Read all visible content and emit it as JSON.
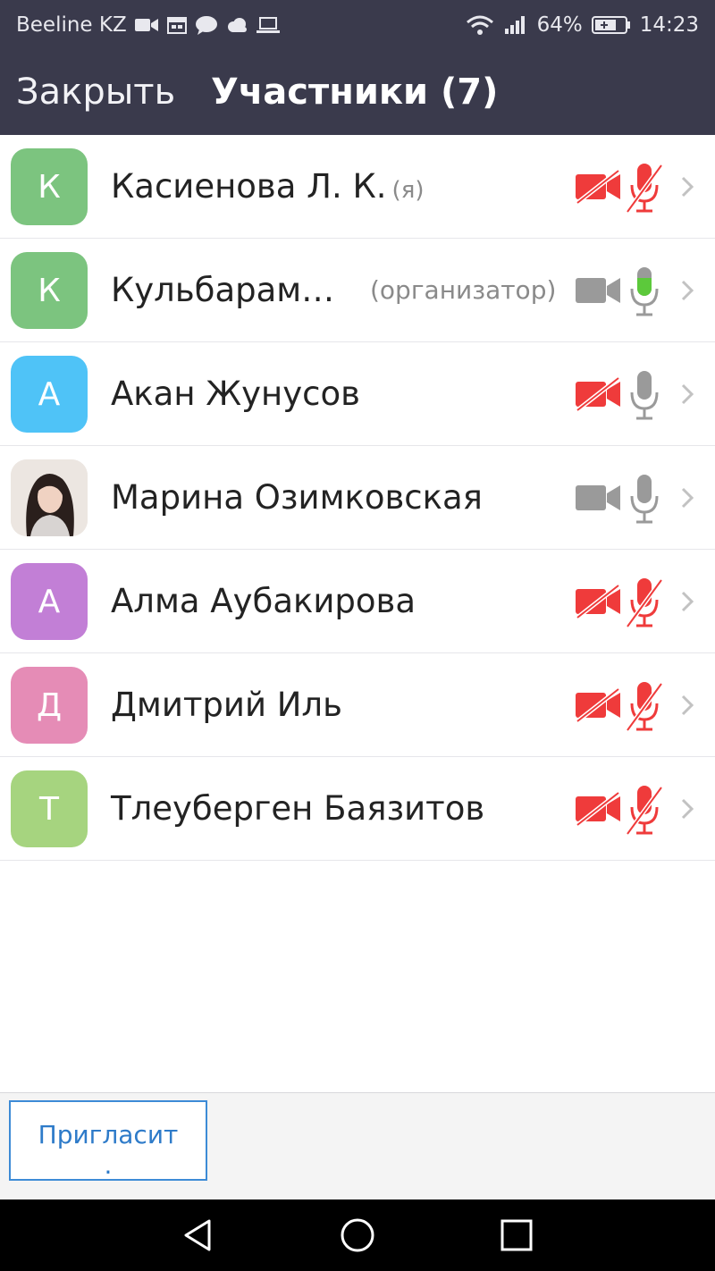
{
  "status_bar": {
    "carrier": "Beeline KZ",
    "battery": "64%",
    "time": "14:23"
  },
  "header": {
    "close_label": "Закрыть",
    "title": "Участники (7)"
  },
  "participants": [
    {
      "initial": "К",
      "name": "Касиенова Л. К.",
      "tag": "(я)",
      "avatar_color": "#7cc47f",
      "video": "off",
      "audio": "muted"
    },
    {
      "initial": "К",
      "name": "Кульбарам…",
      "tag": "(организатор)",
      "avatar_color": "#7cc47f",
      "video": "on",
      "audio": "speaking"
    },
    {
      "initial": "А",
      "name": "Акан Жунусов",
      "tag": "",
      "avatar_color": "#4fc3f7",
      "video": "off",
      "audio": "on"
    },
    {
      "initial": "",
      "name": "Марина Озимковская",
      "tag": "",
      "avatar_color": "photo",
      "video": "on",
      "audio": "on"
    },
    {
      "initial": "А",
      "name": "Алма Аубакирова",
      "tag": "",
      "avatar_color": "#c27fd6",
      "video": "off",
      "audio": "muted"
    },
    {
      "initial": "Д",
      "name": "Дмитрий Иль",
      "tag": "",
      "avatar_color": "#e58cb6",
      "video": "off",
      "audio": "muted"
    },
    {
      "initial": "Т",
      "name": "Тлеуберген Баязитов",
      "tag": "",
      "avatar_color": "#a6d47f",
      "video": "off",
      "audio": "muted"
    }
  ],
  "footer": {
    "invite_label": "Пригласит",
    "invite_label_line2": "."
  },
  "colors": {
    "header_bg": "#3a3a4c",
    "muted_red": "#ef3b3b",
    "icon_gray": "#9a9a9a",
    "speaking_green": "#5cc93b",
    "accent_blue": "#2e7bc9"
  }
}
